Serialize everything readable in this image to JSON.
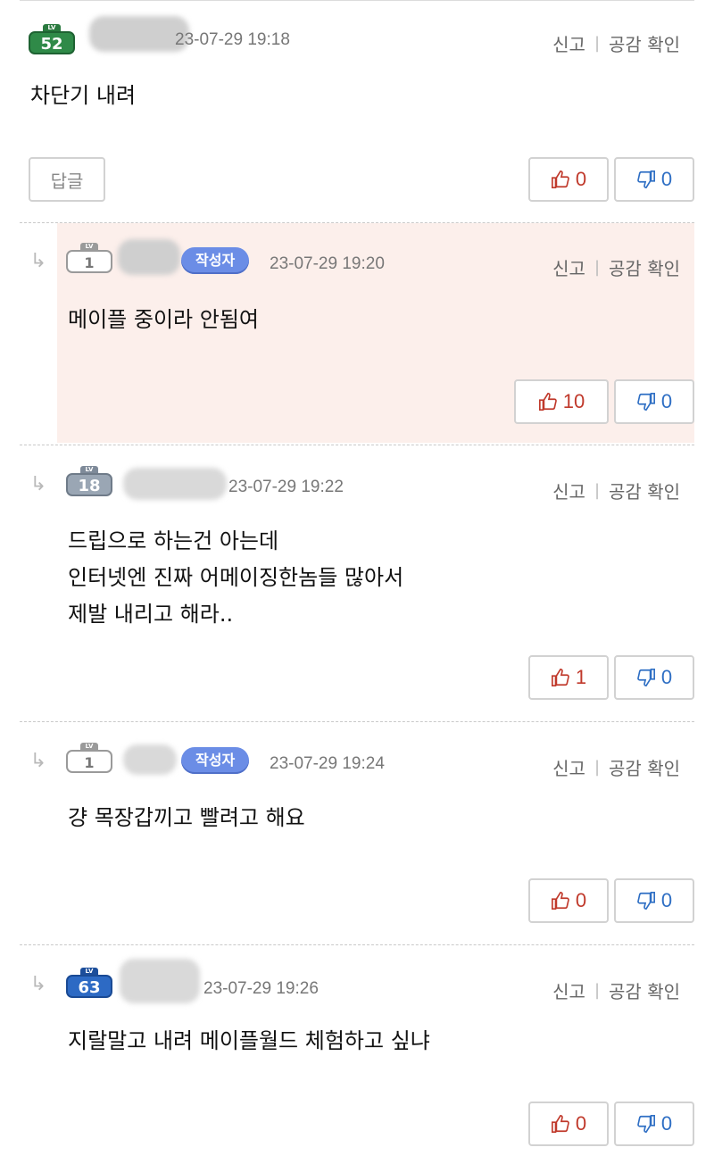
{
  "comments": [
    {
      "level": "52",
      "level_label": "LV",
      "date": "23-07-29 19:18",
      "report": "신고",
      "check_like": "공감 확인",
      "text": [
        "차단기 내려"
      ],
      "reply_label": "답글",
      "likes": "0",
      "dislikes": "0"
    },
    {
      "level": "1",
      "level_label": "LV",
      "author_badge": "작성자",
      "date": "23-07-29 19:20",
      "report": "신고",
      "check_like": "공감 확인",
      "text": [
        "메이플 중이라 안됨여"
      ],
      "likes": "10",
      "dislikes": "0"
    },
    {
      "level": "18",
      "level_label": "LV",
      "date": "23-07-29 19:22",
      "report": "신고",
      "check_like": "공감 확인",
      "text": [
        "드립으로 하는건 아는데",
        "인터넷엔 진짜 어메이징한놈들 많아서",
        "제발 내리고 해라.."
      ],
      "likes": "1",
      "dislikes": "0"
    },
    {
      "level": "1",
      "level_label": "LV",
      "author_badge": "작성자",
      "date": "23-07-29 19:24",
      "report": "신고",
      "check_like": "공감 확인",
      "text": [
        "걍 목장갑끼고 빨려고 해요"
      ],
      "likes": "0",
      "dislikes": "0"
    },
    {
      "level": "63",
      "level_label": "LV",
      "date": "23-07-29 19:26",
      "report": "신고",
      "check_like": "공감 확인",
      "text": [
        "지랄말고 내려 메이플월드 체험하고 싶냐"
      ],
      "likes": "0",
      "dislikes": "0"
    }
  ],
  "icons": {
    "reply_arrow": "↳",
    "thumbs_up": "thumbs-up-icon",
    "thumbs_down": "thumbs-down-icon"
  },
  "colors": {
    "author_background": "#fcefeb",
    "author_badge": "#6b8de6",
    "like_text": "#c0392b",
    "dislike_text": "#2f6fc4"
  }
}
